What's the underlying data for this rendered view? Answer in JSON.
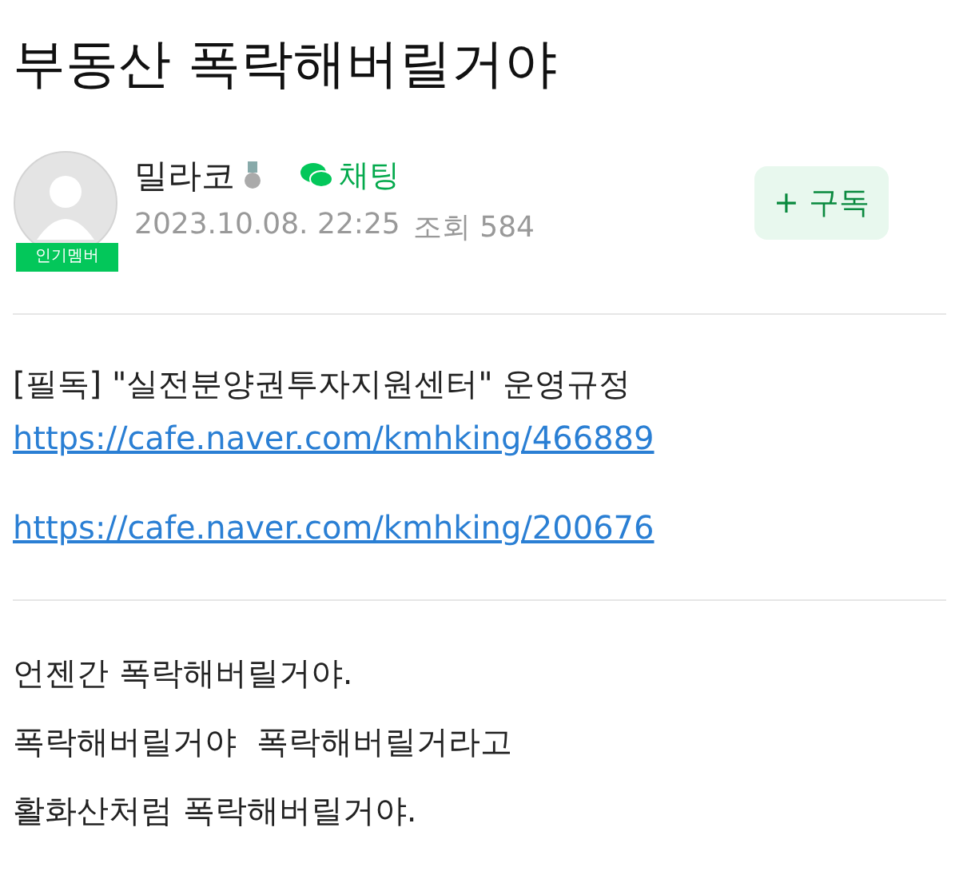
{
  "title": "부동산 폭락해버릴거야",
  "author": {
    "name": "밀라코",
    "badge": "인기멤버",
    "chat": "채팅",
    "date": "2023.10.08. 22:25",
    "views": "조회 584"
  },
  "subscribe": {
    "icon": "+",
    "label": "구독"
  },
  "notice": {
    "blocks": [
      [
        {
          "kind": "text",
          "text": "[필독] \"실전분양권투자지원센터\" 운영규정"
        },
        {
          "kind": "link",
          "text": "https://cafe.naver.com/kmhking/466889"
        }
      ],
      [
        {
          "kind": "link",
          "text": "https://cafe.naver.com/kmhking/200676"
        }
      ]
    ]
  },
  "body": {
    "lines": [
      "언젠간 폭락해버릴거야.",
      "폭락해버릴거야  폭락해버릴거라고",
      "활화산처럼 폭락해버릴거야."
    ]
  }
}
